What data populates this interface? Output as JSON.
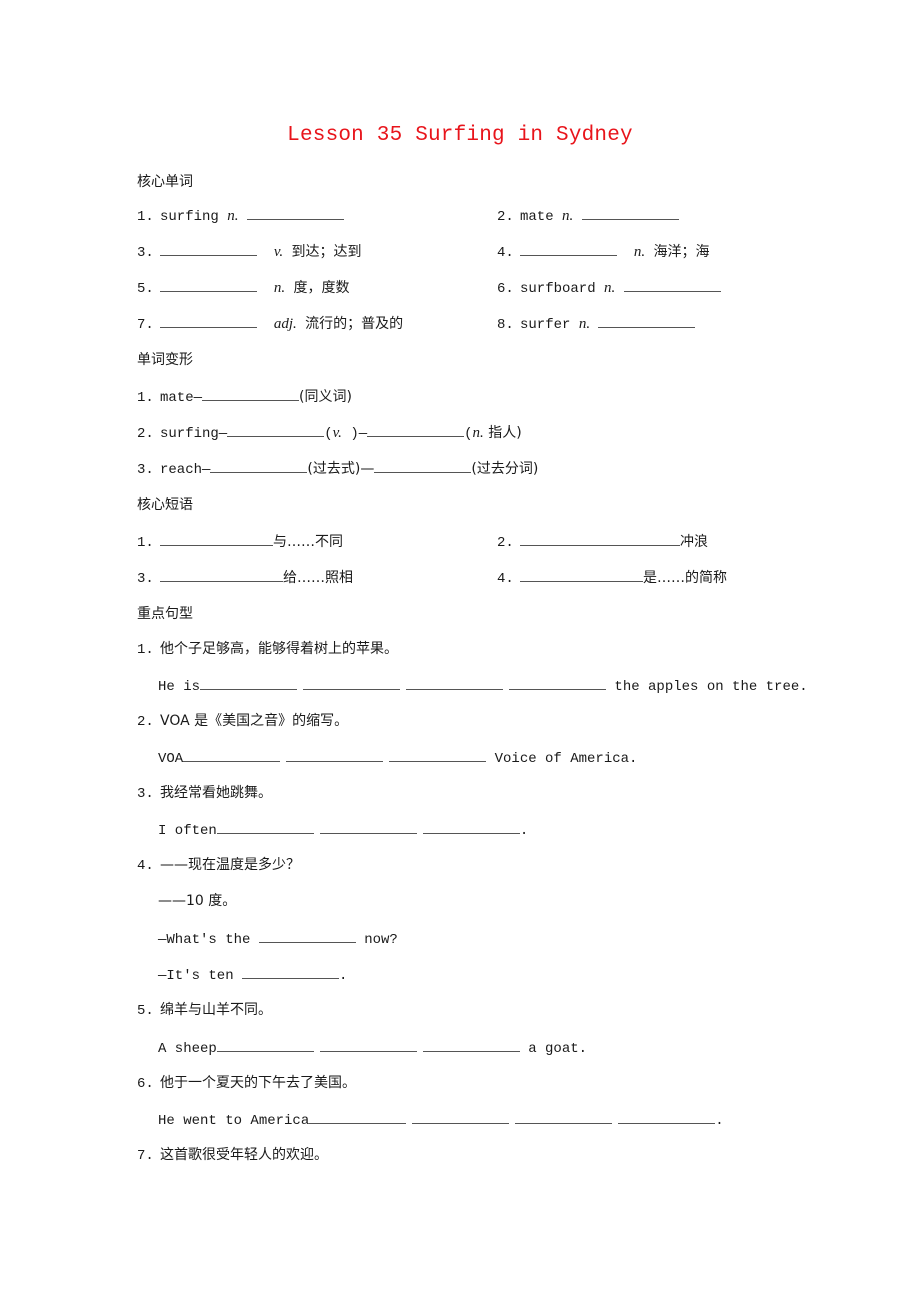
{
  "title": "Lesson 35  Surfing in Sydney",
  "sections": {
    "core_words": {
      "heading": "核心单词",
      "items": [
        {
          "num": "1.",
          "word": "surfing",
          "pos": "n.",
          "meaning": ""
        },
        {
          "num": "2.",
          "word": "mate",
          "pos": "n.",
          "meaning": ""
        },
        {
          "num": "3.",
          "word": "",
          "pos": "v.",
          "meaning": "到达；达到"
        },
        {
          "num": "4.",
          "word": "",
          "pos": "n.",
          "meaning": "海洋；海"
        },
        {
          "num": "5.",
          "word": "",
          "pos": "n.",
          "meaning": "度，度数"
        },
        {
          "num": "6.",
          "word": "surfboard",
          "pos": "n.",
          "meaning": ""
        },
        {
          "num": "7.",
          "word": "",
          "pos": "adj.",
          "meaning": "流行的；普及的"
        },
        {
          "num": "8.",
          "word": "surfer",
          "pos": "n.",
          "meaning": ""
        }
      ]
    },
    "word_forms": {
      "heading": "单词变形",
      "items": [
        {
          "num": "1.",
          "word": "mate—",
          "note1": "(同义词)"
        },
        {
          "num": "2.",
          "word": "surfing—",
          "note1_open": "(",
          "note1_pos": "v.",
          "note1_close": " )—",
          "note2_open": "(",
          "note2_pos": "n.",
          "note2_text": " 指人)"
        },
        {
          "num": "3.",
          "word": "reach—",
          "note1": "(过去式)—",
          "note2": "(过去分词)"
        }
      ]
    },
    "core_phrases": {
      "heading": "核心短语",
      "items": [
        {
          "num": "1.",
          "meaning": "与……不同"
        },
        {
          "num": "2.",
          "meaning": "冲浪"
        },
        {
          "num": "3.",
          "meaning": "给……照相"
        },
        {
          "num": "4.",
          "meaning": "是……的简称"
        }
      ]
    },
    "key_sentences": {
      "heading": "重点句型",
      "items": [
        {
          "num": "1.",
          "cn": "他个子足够高，能够得着树上的苹果。",
          "en_prefix": "He is",
          "en_suffix": " the apples on the tree."
        },
        {
          "num": "2.",
          "cn": "VOA 是《美国之音》的缩写。",
          "en_prefix": "VOA",
          "en_suffix": " Voice of America."
        },
        {
          "num": "3.",
          "cn": "我经常看她跳舞。",
          "en_prefix": "I often",
          "en_suffix": "."
        },
        {
          "num": "4.",
          "cn": "——现在温度是多少？",
          "cn2": "——10 度。",
          "en1_prefix": "—What's the ",
          "en1_suffix": " now?",
          "en2_prefix": "—It's ten ",
          "en2_suffix": "."
        },
        {
          "num": "5.",
          "cn": "绵羊与山羊不同。",
          "en_prefix": "A sheep",
          "en_suffix": " a goat."
        },
        {
          "num": "6.",
          "cn": "他于一个夏天的下午去了美国。",
          "en_prefix": "He went to America",
          "en_suffix": "."
        },
        {
          "num": "7.",
          "cn": "这首歌很受年轻人的欢迎。"
        }
      ]
    }
  }
}
